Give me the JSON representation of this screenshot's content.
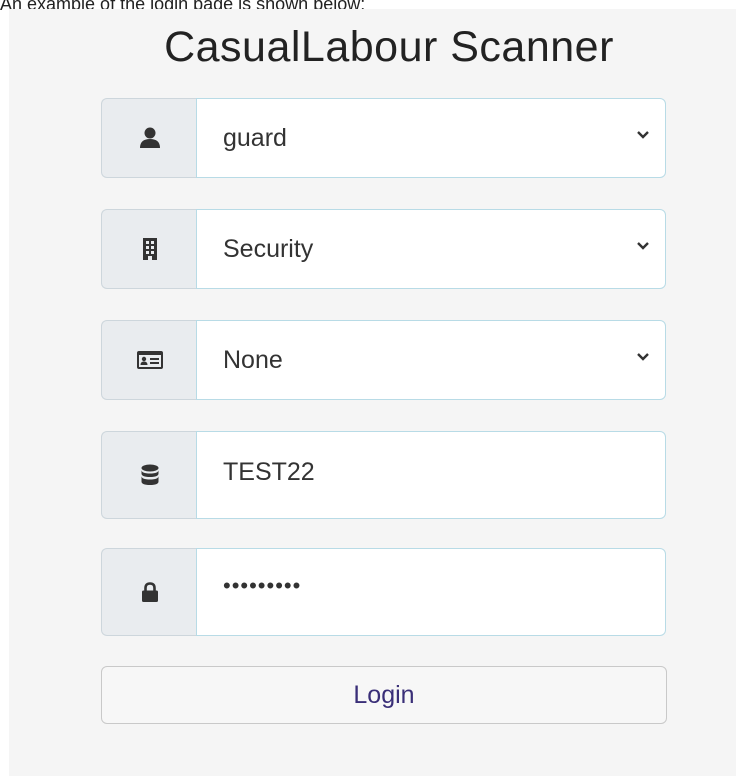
{
  "caption": "An example of the login page is shown below:",
  "title": "CasualLabour Scanner",
  "fields": [
    {
      "icon": "user-icon",
      "value": "guard",
      "type": "select"
    },
    {
      "icon": "building-icon",
      "value": "Security",
      "type": "select"
    },
    {
      "icon": "id-card-icon",
      "value": "None",
      "type": "select"
    },
    {
      "icon": "database-icon",
      "value": "TEST22",
      "type": "text"
    },
    {
      "icon": "lock-icon",
      "value": "•••••••••",
      "type": "password"
    }
  ],
  "login_label": "Login",
  "colors": {
    "panel_bg": "#f5f5f5",
    "addon_bg": "#e9ecef",
    "field_border": "#b8dbe6",
    "login_text": "#3a2f78"
  }
}
